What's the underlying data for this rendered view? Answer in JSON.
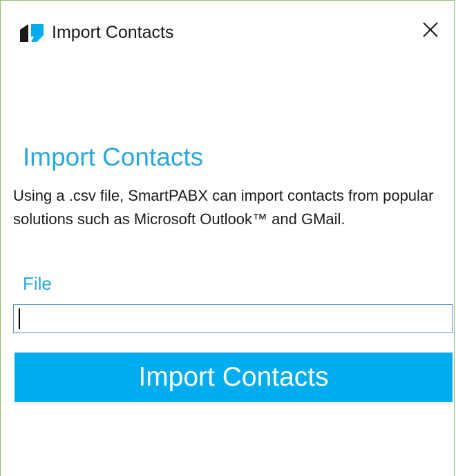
{
  "window": {
    "title": "Import Contacts",
    "app_icon": "smartpabx-logo-icon",
    "close_icon": "close-icon"
  },
  "main": {
    "heading": "Import Contacts",
    "description": "Using a .csv file, SmartPABX can import contacts from popular solutions such as Microsoft Outlook™ and GMail.",
    "file_label": "File",
    "file_value": "",
    "file_placeholder": "",
    "import_button_label": "Import Contacts"
  },
  "colors": {
    "accent": "#29a8e0",
    "button": "#00adef",
    "window_border": "#8ac46a",
    "input_border": "#5b8fd6"
  }
}
